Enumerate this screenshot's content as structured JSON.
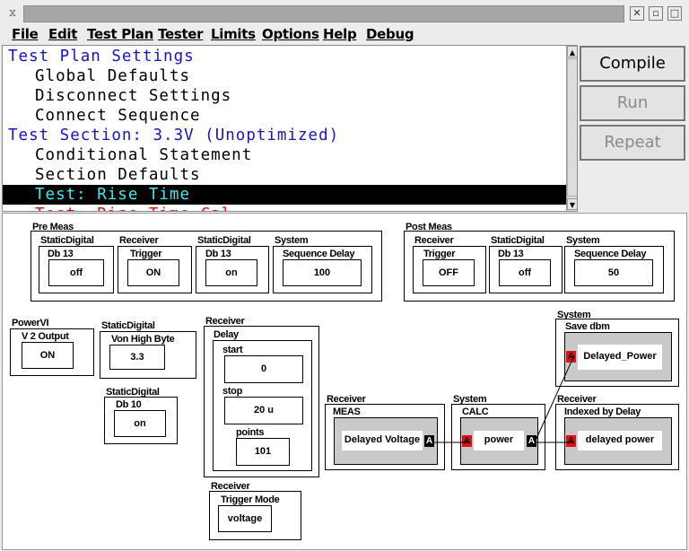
{
  "menubar": {
    "items": [
      "File",
      "Edit",
      "Test Plan",
      "Tester",
      "Limits",
      "Options",
      "Help",
      "Debug"
    ]
  },
  "tree": {
    "items": [
      {
        "text": "Test Plan Settings"
      },
      {
        "text": "Global Defaults"
      },
      {
        "text": "Disconnect Settings"
      },
      {
        "text": "Connect Sequence"
      },
      {
        "text": "Test Section: 3.3V (Unoptimized)"
      },
      {
        "text": "Conditional Statement"
      },
      {
        "text": "Section Defaults"
      },
      {
        "text": "Test: Rise Time"
      },
      {
        "text": "Test: Rise Time Cal"
      }
    ]
  },
  "buttons": {
    "compile": "Compile",
    "run": "Run",
    "repeat": "Repeat"
  },
  "diagram": {
    "pre_meas": {
      "title": "Pre Meas",
      "b1": {
        "type": "StaticDigital",
        "param": "Db 13",
        "value": "off"
      },
      "b2": {
        "type": "Receiver",
        "param": "Trigger",
        "value": "ON"
      },
      "b3": {
        "type": "StaticDigital",
        "param": "Db 13",
        "value": "on"
      },
      "b4": {
        "type": "System",
        "param": "Sequence Delay",
        "value": "100"
      }
    },
    "post_meas": {
      "title": "Post Meas",
      "b1": {
        "type": "Receiver",
        "param": "Trigger",
        "value": "OFF"
      },
      "b2": {
        "type": "StaticDigital",
        "param": "Db 13",
        "value": "off"
      },
      "b3": {
        "type": "System",
        "param": "Sequence Delay",
        "value": "50"
      }
    },
    "powervi": {
      "type": "PowerVI",
      "param": "V 2 Output",
      "value": "ON"
    },
    "sd_von": {
      "type": "StaticDigital",
      "param": "Von High Byte",
      "value": "3.3"
    },
    "sd_db10": {
      "type": "StaticDigital",
      "param": "Db 10",
      "value": "on"
    },
    "rx_delay": {
      "type": "Receiver",
      "param": "Delay",
      "start_label": "start",
      "start": "0",
      "stop_label": "stop",
      "stop": "20 u",
      "points_label": "points",
      "points": "101"
    },
    "rx_trigger": {
      "type": "Receiver",
      "param": "Trigger Mode",
      "value": "voltage"
    },
    "rx_meas": {
      "type": "Receiver",
      "param": "MEAS",
      "value": "Delayed Voltage",
      "port": "A"
    },
    "sys_calc": {
      "type": "System",
      "param": "CALC",
      "value": "power",
      "port_in": "A",
      "port_out": "A"
    },
    "rx_indexed": {
      "type": "Receiver",
      "param": "Indexed by Delay",
      "value": "delayed power",
      "port": "A"
    },
    "sys_save": {
      "type": "System",
      "param": "Save dbm",
      "value": "Delayed_Power",
      "port": "A"
    }
  }
}
